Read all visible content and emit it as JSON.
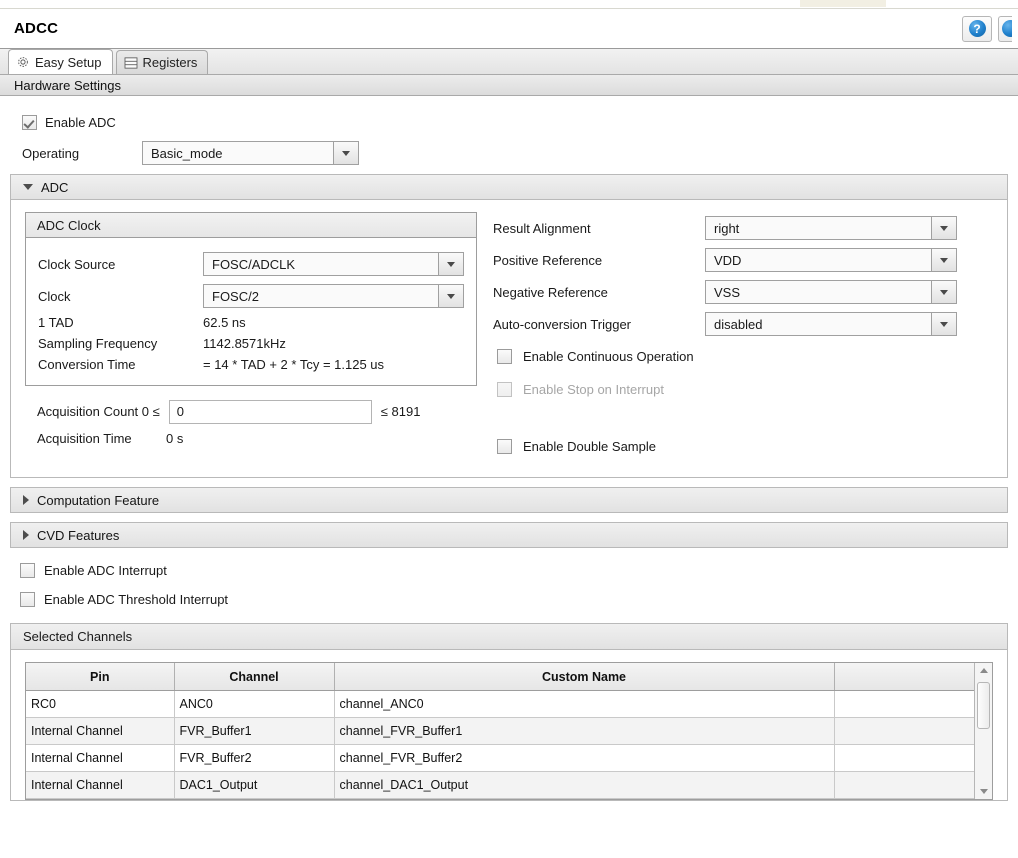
{
  "window": {
    "title": "ADCC",
    "help_icon": "help-circle-icon",
    "help_glyph": "?",
    "secondary_icon": "partially-visible-button-icon",
    "accent_color": "#1f80cc"
  },
  "tabs": [
    {
      "label": "Easy Setup",
      "icon": "gear-icon",
      "active": true
    },
    {
      "label": "Registers",
      "icon": "registers-list-icon",
      "active": false
    }
  ],
  "section_bar": {
    "label": "Hardware Settings"
  },
  "top_form": {
    "enable_adc": {
      "label": "Enable ADC",
      "checked": true
    },
    "operating": {
      "label": "Operating",
      "value": "Basic_mode"
    }
  },
  "adc_group": {
    "title": "ADC",
    "expanded": true,
    "clock_fieldset": {
      "title": "ADC Clock",
      "fields": [
        {
          "label": "Clock Source",
          "value": "FOSC/ADCLK"
        },
        {
          "label": "Clock",
          "value": "FOSC/2"
        }
      ],
      "info": [
        {
          "label": "1 TAD",
          "value": "62.5 ns"
        },
        {
          "label": "Sampling Frequency",
          "value": "1142.8571kHz"
        },
        {
          "label": "Conversion Time",
          "value": "= 14 * TAD + 2 * Tcy = 1.125 us"
        }
      ]
    },
    "acquisition": {
      "count_label": "Acquisition Count 0 ≤",
      "count_value": "0",
      "count_max": "≤ 8191",
      "time_label": "Acquisition Time",
      "time_value": "0 s"
    },
    "right_fields": [
      {
        "label": "Result Alignment",
        "value": "right"
      },
      {
        "label": "Positive Reference",
        "value": "VDD"
      },
      {
        "label": "Negative Reference",
        "value": "VSS"
      },
      {
        "label": "Auto-conversion Trigger",
        "value": "disabled"
      }
    ],
    "right_checkboxes": [
      {
        "label": "Enable Continuous Operation",
        "checked": false,
        "disabled": false
      },
      {
        "label": "Enable Stop on Interrupt",
        "checked": false,
        "disabled": true
      },
      {
        "label": "Enable Double Sample",
        "checked": false,
        "disabled": false
      }
    ]
  },
  "collapsed_groups": [
    {
      "title": "Computation Feature",
      "expanded": false
    },
    {
      "title": "CVD Features",
      "expanded": false
    }
  ],
  "interrupt_checkboxes": [
    {
      "label": "Enable ADC Interrupt",
      "checked": false
    },
    {
      "label": "Enable ADC Threshold Interrupt",
      "checked": false
    }
  ],
  "selected_channels": {
    "title": "Selected Channels",
    "columns": [
      "Pin",
      "Channel",
      "Custom Name",
      ""
    ],
    "rows": [
      {
        "pin": "RC0",
        "channel": "ANC0",
        "custom_name": "channel_ANC0"
      },
      {
        "pin": "Internal Channel",
        "channel": "FVR_Buffer1",
        "custom_name": "channel_FVR_Buffer1"
      },
      {
        "pin": "Internal Channel",
        "channel": "FVR_Buffer2",
        "custom_name": "channel_FVR_Buffer2"
      },
      {
        "pin": "Internal Channel",
        "channel": "DAC1_Output",
        "custom_name": "channel_DAC1_Output"
      }
    ],
    "scrollbar": {
      "up": "scroll-up-arrow",
      "down": "scroll-down-arrow"
    }
  }
}
